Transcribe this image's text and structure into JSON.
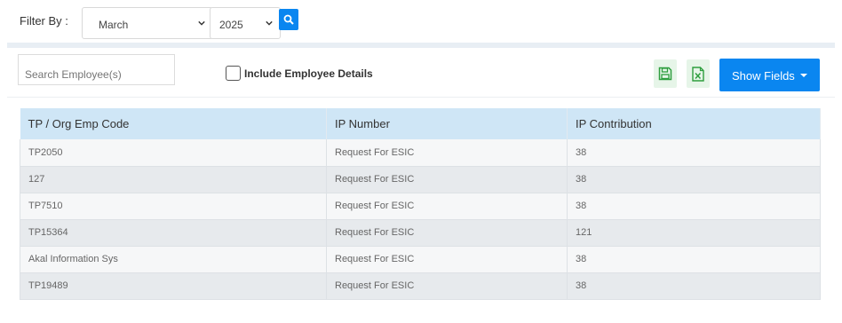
{
  "filter": {
    "label": "Filter By :",
    "month": "March",
    "year": "2025"
  },
  "toolbar": {
    "search_placeholder": "Search Employee(s)",
    "include_details_label": "Include Employee Details",
    "include_details_checked": false,
    "save_icon": "floppy-disk-icon",
    "excel_icon": "excel-file-icon",
    "show_fields_label": "Show Fields"
  },
  "colors": {
    "accent": "#0a86f0",
    "header_bg": "#cfe6f6",
    "icon_green": "#2e9e3e"
  },
  "table": {
    "columns": [
      "TP / Org Emp Code",
      "IP Number",
      "IP Contribution"
    ],
    "rows": [
      [
        "TP2050",
        "Request For ESIC",
        "38"
      ],
      [
        "127",
        "Request For ESIC",
        "38"
      ],
      [
        "TP7510",
        "Request For ESIC",
        "38"
      ],
      [
        "TP15364",
        "Request For ESIC",
        "121"
      ],
      [
        "Akal Information Sys",
        "Request For ESIC",
        "38"
      ],
      [
        "TP19489",
        "Request For ESIC",
        "38"
      ]
    ]
  }
}
